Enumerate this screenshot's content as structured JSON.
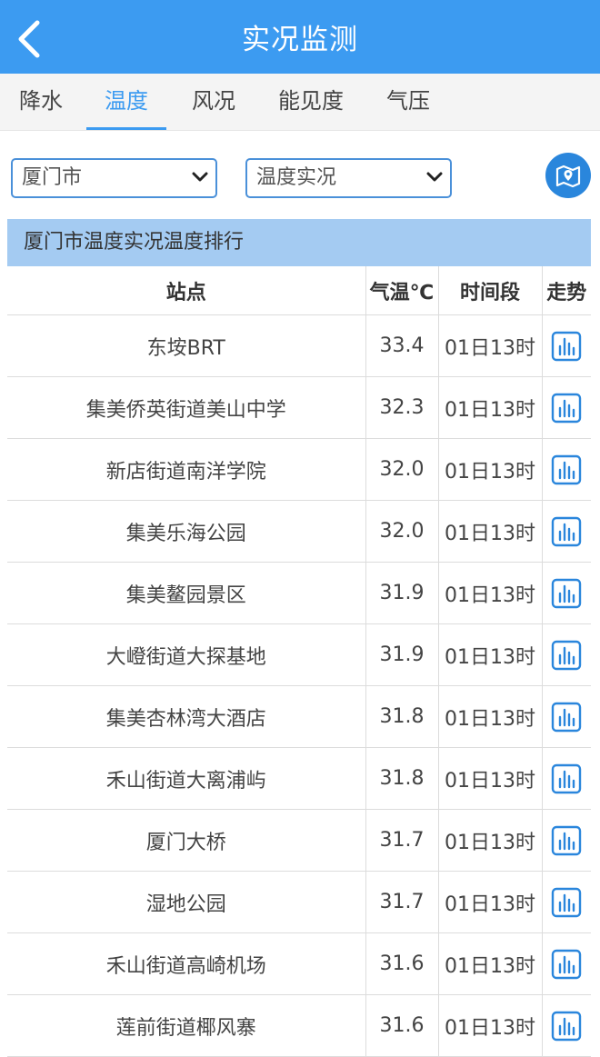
{
  "header": {
    "title": "实况监测"
  },
  "tabs": [
    {
      "label": "降水"
    },
    {
      "label": "温度"
    },
    {
      "label": "风况"
    },
    {
      "label": "能见度"
    },
    {
      "label": "气压"
    }
  ],
  "filters": {
    "city": "厦门市",
    "type": "温度实况"
  },
  "table": {
    "caption": "厦门市温度实况温度排行",
    "columns": [
      "站点",
      "气温℃",
      "时间段",
      "走势"
    ],
    "rows": [
      {
        "station": "东垵BRT",
        "temp": "33.4",
        "time": "01日13时"
      },
      {
        "station": "集美侨英街道美山中学",
        "temp": "32.3",
        "time": "01日13时"
      },
      {
        "station": "新店街道南洋学院",
        "temp": "32.0",
        "time": "01日13时"
      },
      {
        "station": "集美乐海公园",
        "temp": "32.0",
        "time": "01日13时"
      },
      {
        "station": "集美鳌园景区",
        "temp": "31.9",
        "time": "01日13时"
      },
      {
        "station": "大嶝街道大探基地",
        "temp": "31.9",
        "time": "01日13时"
      },
      {
        "station": "集美杏林湾大酒店",
        "temp": "31.8",
        "time": "01日13时"
      },
      {
        "station": "禾山街道大离浦屿",
        "temp": "31.8",
        "time": "01日13时"
      },
      {
        "station": "厦门大桥",
        "temp": "31.7",
        "time": "01日13时"
      },
      {
        "station": "湿地公园",
        "temp": "31.7",
        "time": "01日13时"
      },
      {
        "station": "禾山街道高崎机场",
        "temp": "31.6",
        "time": "01日13时"
      },
      {
        "station": "莲前街道椰风寨",
        "temp": "31.6",
        "time": "01日13时"
      }
    ]
  },
  "colors": {
    "accent": "#3c9bf1",
    "caption_bg": "#a4cbf2",
    "trend_icon": "#2a86dc"
  }
}
